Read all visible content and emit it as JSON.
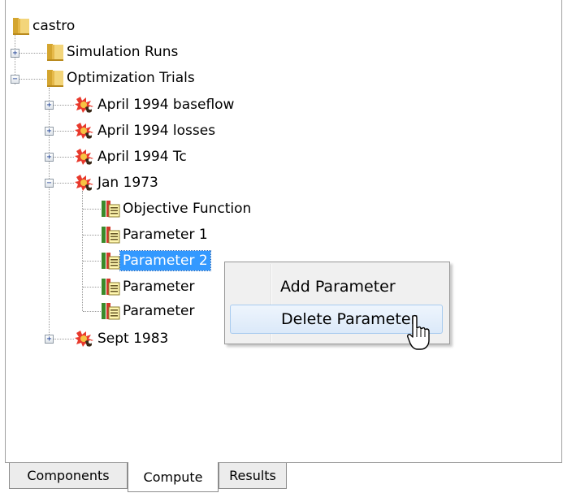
{
  "tree": {
    "root": {
      "label": "castro"
    },
    "simulation_runs": {
      "label": "Simulation Runs"
    },
    "optimization_trials": {
      "label": "Optimization Trials",
      "trials": [
        {
          "label": "April 1994 baseflow"
        },
        {
          "label": "April 1994 losses"
        },
        {
          "label": "April 1994 Tc"
        },
        {
          "label": "Jan 1973"
        },
        {
          "label": "Sept 1983"
        }
      ],
      "jan1973_children": [
        {
          "label": "Objective Function"
        },
        {
          "label": "Parameter 1"
        },
        {
          "label": "Parameter 2"
        },
        {
          "label": "Parameter"
        },
        {
          "label": "Parameter"
        }
      ]
    }
  },
  "context_menu": {
    "items": [
      {
        "label": "Add Parameter"
      },
      {
        "label": "Delete Parameter"
      }
    ]
  },
  "tabs": [
    {
      "label": "Components"
    },
    {
      "label": "Compute"
    },
    {
      "label": "Results"
    }
  ],
  "colors": {
    "selection": "#3399ff",
    "menu_hover": "#dbe9f9",
    "folder": "#e9c45a",
    "trial_icon": "#e8392c"
  },
  "icons": {
    "folder": "folder-icon",
    "trial": "optimization-trial-icon",
    "parameter": "parameter-icon"
  }
}
